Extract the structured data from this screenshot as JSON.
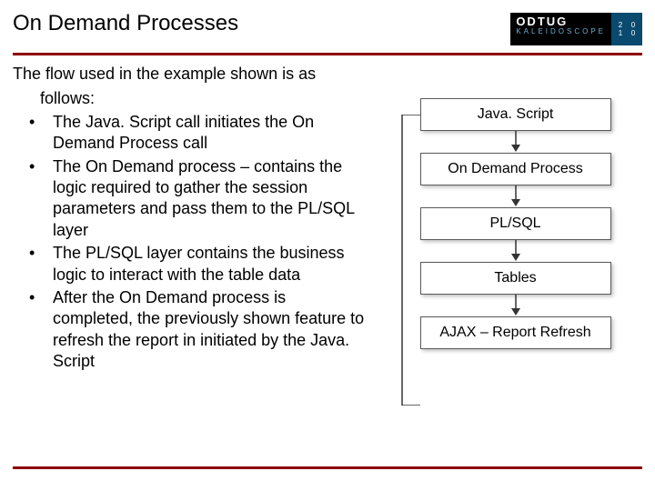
{
  "header": {
    "title": "On Demand Processes",
    "logo": {
      "line1": "ODTUG",
      "line2": "KALEIDOSCOPE",
      "year_digits": [
        "2",
        "0",
        "1",
        "0"
      ]
    }
  },
  "content": {
    "intro_line1": "The flow used in the example shown is as",
    "intro_line2": "follows:",
    "bullets": [
      "The Java. Script call initiates the On Demand Process call",
      "The On Demand process – contains the logic required to gather the session parameters and pass them to the PL/SQL layer",
      "The PL/SQL layer contains the business logic to interact with the table data",
      "After the On Demand process is completed, the previously shown feature to refresh the report in initiated by the Java. Script"
    ]
  },
  "diagram": {
    "nodes": [
      "Java. Script",
      "On Demand Process",
      "PL/SQL",
      "Tables",
      "AJAX – Report Refresh"
    ]
  }
}
